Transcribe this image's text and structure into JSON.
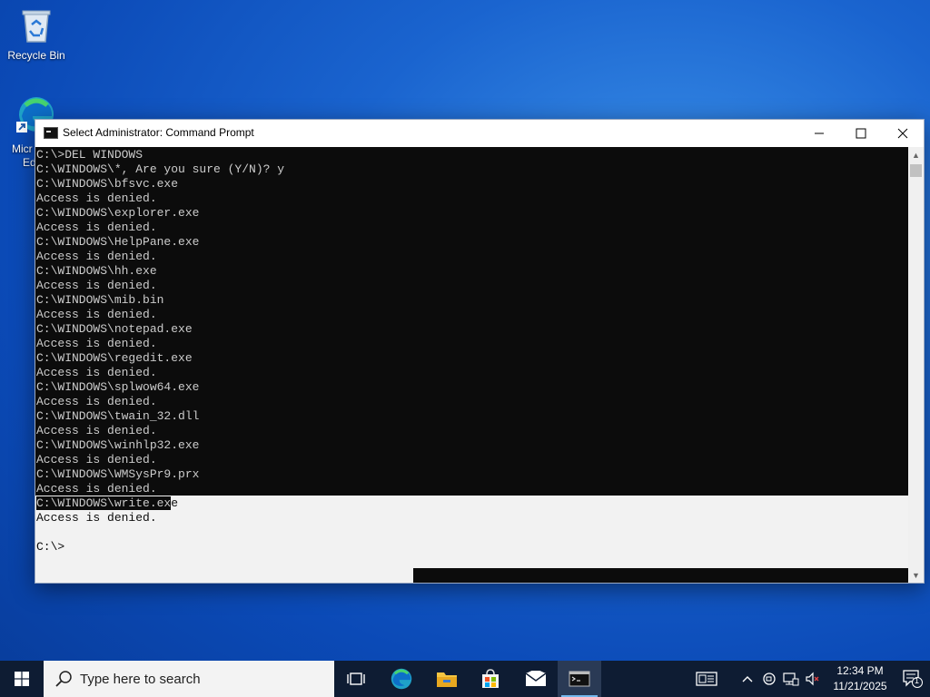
{
  "desktop": {
    "icons": [
      {
        "label": "Recycle Bin"
      },
      {
        "label_line1": "Micr",
        "label_line2": "Ed"
      }
    ]
  },
  "window": {
    "title": "Select Administrator: Command Prompt",
    "controls": {
      "minimize": "—",
      "maximize": "☐",
      "close": "✕"
    },
    "console_lines": [
      "C:\\>DEL WINDOWS",
      "C:\\WINDOWS\\*, Are you sure (Y/N)? y",
      "C:\\WINDOWS\\bfsvc.exe",
      "Access is denied.",
      "C:\\WINDOWS\\explorer.exe",
      "Access is denied.",
      "C:\\WINDOWS\\HelpPane.exe",
      "Access is denied.",
      "C:\\WINDOWS\\hh.exe",
      "Access is denied.",
      "C:\\WINDOWS\\mib.bin",
      "Access is denied.",
      "C:\\WINDOWS\\notepad.exe",
      "Access is denied.",
      "C:\\WINDOWS\\regedit.exe",
      "Access is denied.",
      "C:\\WINDOWS\\splwow64.exe",
      "Access is denied.",
      "C:\\WINDOWS\\twain_32.dll",
      "Access is denied.",
      "C:\\WINDOWS\\winhlp32.exe",
      "Access is denied.",
      "C:\\WINDOWS\\WMSysPr9.prx",
      "Access is denied."
    ],
    "partial_line": {
      "unselected": "C:\\WINDOWS\\write.ex",
      "selected": "e"
    },
    "selected_lines": [
      "Access is denied.",
      "",
      "C:\\>"
    ]
  },
  "taskbar": {
    "search_placeholder": "Type here to search",
    "pinned": [
      "task-view",
      "edge",
      "file-explorer",
      "microsoft-store",
      "mail",
      "command-prompt"
    ],
    "clock": {
      "time": "12:34 PM",
      "date": "11/21/2025"
    },
    "notification_count": "1"
  },
  "colors": {
    "console_bg": "#0c0c0c",
    "console_text": "#cccccc",
    "selection_bg": "#f2f2f2",
    "taskbar_bg": "#0e1c33"
  }
}
